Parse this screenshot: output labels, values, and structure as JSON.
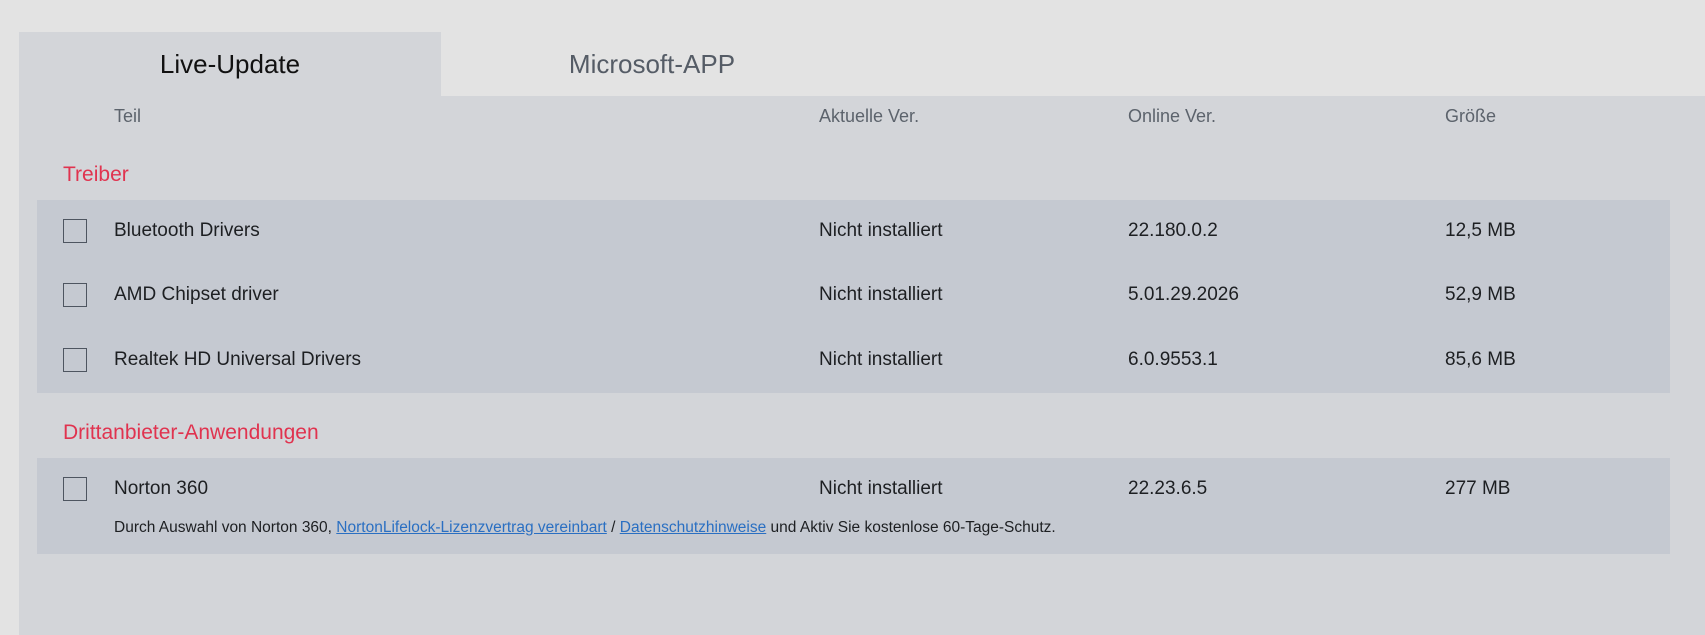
{
  "tabs": {
    "live_update": "Live-Update",
    "microsoft_app": "Microsoft-APP"
  },
  "columns": {
    "part": "Teil",
    "current_version": "Aktuelle Ver.",
    "online_version": "Online Ver.",
    "size": "Größe"
  },
  "sections": {
    "drivers": {
      "title": "Treiber",
      "rows": [
        {
          "name": "Bluetooth Drivers",
          "current": "Nicht installiert",
          "online": "22.180.0.2",
          "size": "12,5 MB"
        },
        {
          "name": "AMD Chipset driver",
          "current": "Nicht installiert",
          "online": "5.01.29.2026",
          "size": "52,9 MB"
        },
        {
          "name": "Realtek HD Universal Drivers",
          "current": "Nicht installiert",
          "online": "6.0.9553.1",
          "size": "85,6 MB"
        }
      ]
    },
    "third_party": {
      "title": "Drittanbieter-Anwendungen",
      "rows": [
        {
          "name": "Norton 360",
          "current": "Nicht installiert",
          "online": "22.23.6.5",
          "size": "277 MB"
        }
      ],
      "note": {
        "prefix": "Durch Auswahl von Norton 360, ",
        "license_link": "NortonLifelock-Lizenzvertrag vereinbart",
        "separator": " / ",
        "privacy_link": "Datenschutzhinweise",
        "suffix": " und Aktiv Sie kostenlose 60-Tage-Schutz."
      }
    }
  },
  "colors": {
    "accent_section": "#e0334f",
    "link": "#2a6fc2",
    "panel": "#d3d5d9",
    "row_group": "#c5c9d1"
  }
}
